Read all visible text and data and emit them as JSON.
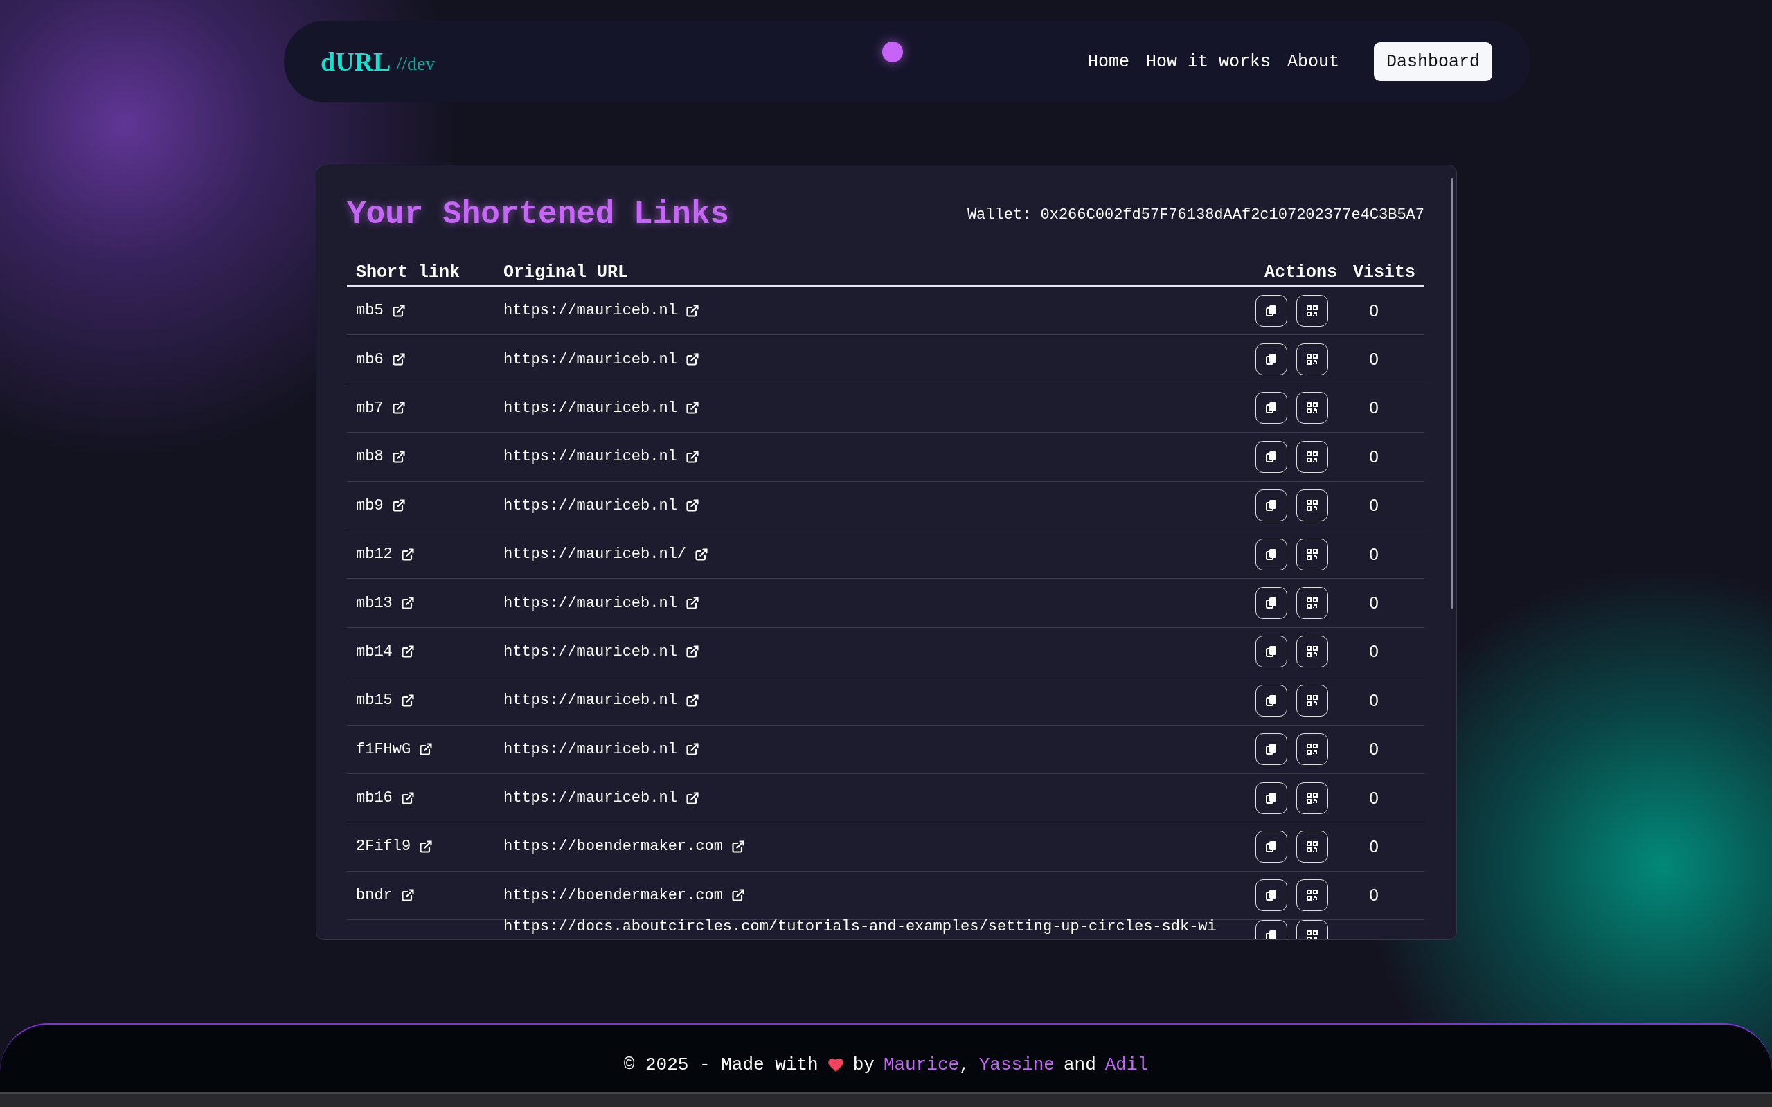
{
  "nav": {
    "logo": "dURL",
    "logo_suffix": "//dev",
    "links": [
      "Home",
      "How it works",
      "About"
    ],
    "button": "Dashboard"
  },
  "card": {
    "title": "Your Shortened Links",
    "wallet": "Wallet: 0x266C002fd57F76138dAAf2c107202377e4C3B5A7"
  },
  "table": {
    "columns": [
      "Short link",
      "Original URL",
      "Actions",
      "Visits"
    ],
    "rows": [
      {
        "short": "mb5",
        "original": "https://mauriceb.nl",
        "visits": "0"
      },
      {
        "short": "mb6",
        "original": "https://mauriceb.nl",
        "visits": "0"
      },
      {
        "short": "mb7",
        "original": "https://mauriceb.nl",
        "visits": "0"
      },
      {
        "short": "mb8",
        "original": "https://mauriceb.nl",
        "visits": "0"
      },
      {
        "short": "mb9",
        "original": "https://mauriceb.nl",
        "visits": "0"
      },
      {
        "short": "mb12",
        "original": "https://mauriceb.nl/",
        "visits": "0"
      },
      {
        "short": "mb13",
        "original": "https://mauriceb.nl",
        "visits": "0"
      },
      {
        "short": "mb14",
        "original": "https://mauriceb.nl",
        "visits": "0"
      },
      {
        "short": "mb15",
        "original": "https://mauriceb.nl",
        "visits": "0"
      },
      {
        "short": "f1FHwG",
        "original": "https://mauriceb.nl",
        "visits": "0"
      },
      {
        "short": "mb16",
        "original": "https://mauriceb.nl",
        "visits": "0"
      },
      {
        "short": "2Fifl9",
        "original": "https://boendermaker.com",
        "visits": "0"
      },
      {
        "short": "bndr",
        "original": "https://boendermaker.com",
        "visits": "0"
      },
      {
        "original": "https://docs.aboutcircles.com/tutorials-and-examples/setting-up-circles-sdk-wi"
      }
    ]
  },
  "footer": {
    "parts": [
      {
        "kind": "text",
        "text": "© 2025 - Made with"
      },
      {
        "kind": "heart"
      },
      {
        "kind": "text",
        "text": "by"
      },
      {
        "kind": "link",
        "text": "Maurice"
      },
      {
        "kind": "punct",
        "text": ","
      },
      {
        "kind": "link",
        "text": "Yassine"
      },
      {
        "kind": "text",
        "text": "and"
      },
      {
        "kind": "link",
        "text": "Adil"
      }
    ]
  }
}
